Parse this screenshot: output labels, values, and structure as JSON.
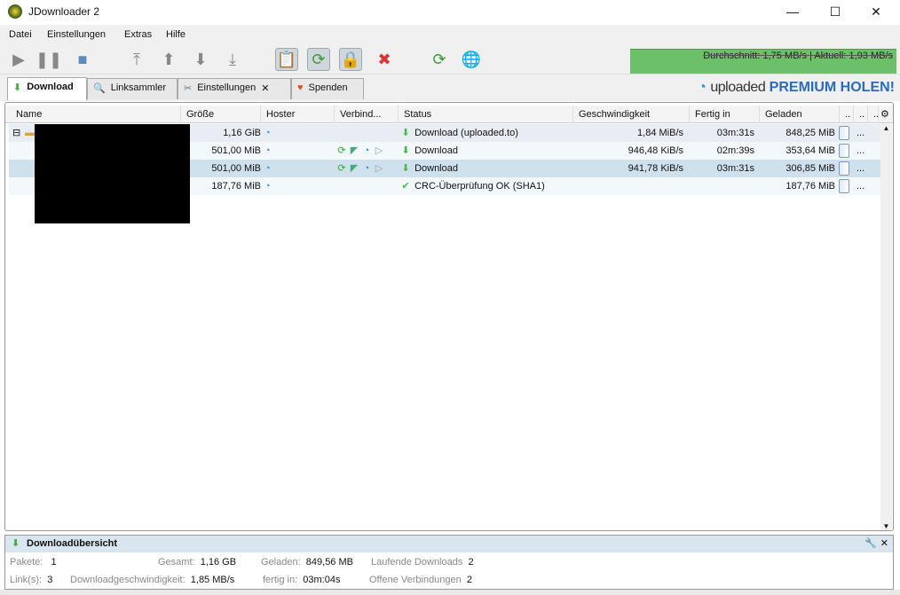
{
  "window": {
    "title": "JDownloader 2",
    "minimize": "—",
    "maximize": "☐",
    "close": "✕"
  },
  "menu": [
    "Datei",
    "Einstellungen",
    "Extras",
    "Hilfe"
  ],
  "speed_meter": "Durchschnitt: 1,75 MB/s | Aktuell: 1,93 MB/s",
  "tabs": [
    {
      "label": "Download"
    },
    {
      "label": "Linksammler"
    },
    {
      "label": "Einstellungen",
      "close": "✕"
    },
    {
      "label": "Spenden"
    }
  ],
  "promo": {
    "brand": "uploaded",
    "text": "PREMIUM HOLEN!"
  },
  "columns": [
    "Name",
    "Größe",
    "Hoster",
    "Verbind...",
    "Status",
    "Geschwindigkeit",
    "Fertig in",
    "Geladen",
    "..",
    "..",
    ".."
  ],
  "rows": [
    {
      "size": "1,16 GiB",
      "status": "Download (uploaded.to)",
      "speed": "1,84 MiB/s",
      "eta": "03m:31s",
      "loaded": "848,25 MiB",
      "more": "..."
    },
    {
      "size": "501,00 MiB",
      "status": "Download",
      "speed": "946,48 KiB/s",
      "eta": "02m:39s",
      "loaded": "353,64 MiB",
      "more": "..."
    },
    {
      "size": "501,00 MiB",
      "status": "Download",
      "speed": "941,78 KiB/s",
      "eta": "03m:31s",
      "loaded": "306,85 MiB",
      "more": "..."
    },
    {
      "size": "187,76 MiB",
      "status": "CRC-Überprüfung OK (SHA1)",
      "speed": "",
      "eta": "",
      "loaded": "187,76 MiB",
      "more": "..."
    }
  ],
  "overview": {
    "title": "Downloadübersicht",
    "pakete_label": "Pakete:",
    "pakete": "1",
    "links_label": "Link(s):",
    "links": "3",
    "gesamt_label": "Gesamt:",
    "gesamt": "1,16 GB",
    "speed_label": "Downloadgeschwindigkeit:",
    "speed": "1,85 MB/s",
    "geladen_label": "Geladen:",
    "geladen": "849,56 MB",
    "fertig_label": "fertig in:",
    "fertig": "03m:04s",
    "laufend_label": "Laufende Downloads",
    "laufend": "2",
    "offen_label": "Offene Verbindungen",
    "offen": "2"
  }
}
